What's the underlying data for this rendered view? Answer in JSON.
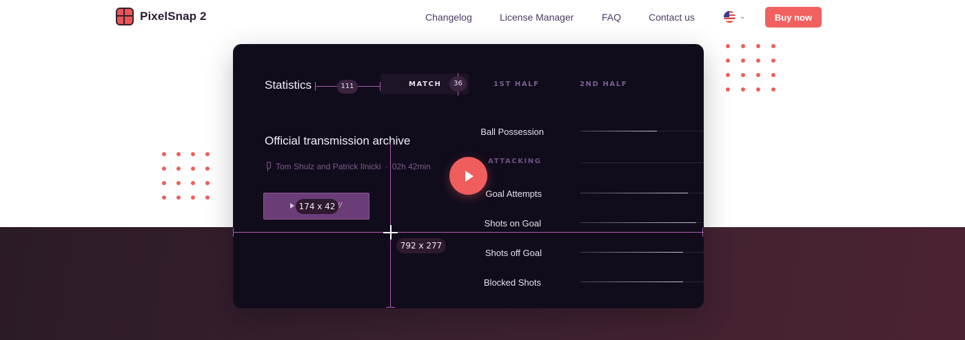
{
  "header": {
    "brand": "PixelSnap 2",
    "nav": [
      "Changelog",
      "License Manager",
      "FAQ",
      "Contact us"
    ],
    "language_icon": "us-flag-icon",
    "buy_label": "Buy now"
  },
  "colors": {
    "accent": "#f0615f",
    "card_bg": "#110c1c",
    "measure": "#b05cb3",
    "band": "#3a2130"
  },
  "demo": {
    "stats_title": "Statistics",
    "tabs": [
      "MATCH",
      "1ST HALF",
      "2ND HALF"
    ],
    "archive_title": "Official transmission archive",
    "authors": "Tom Shulz and Patrick Ilnicki",
    "separator": "·",
    "duration": "02h 42min",
    "section_label": "ATTACKING",
    "stats": [
      {
        "label": "Ball Possession",
        "fill": 0.62
      },
      {
        "label": "Goal Attempts",
        "fill": 0.87
      },
      {
        "label": "Shots on Goal",
        "fill": 0.94
      },
      {
        "label": "Shots off Goal",
        "fill": 0.83
      },
      {
        "label": "Blocked Shots",
        "fill": 0.83
      }
    ]
  },
  "measurements": {
    "gap_width": "111",
    "tab_height": "36",
    "button_size": "174 x 42",
    "button_suffix": "//",
    "area_size": "792 x 277"
  }
}
